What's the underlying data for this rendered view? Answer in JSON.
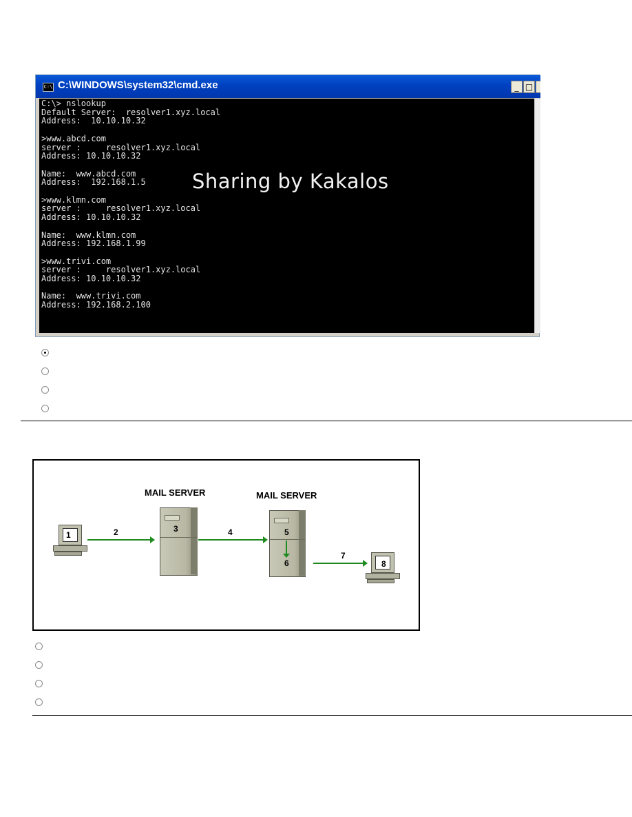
{
  "cmd_window": {
    "title": "C:\\WINDOWS\\system32\\cmd.exe",
    "icon_text": "C:\\",
    "minimize_label": "_",
    "maximize_label": "□",
    "close_label": "",
    "console_text": "C:\\> nslookup\nDefault Server:  resolver1.xyz.local\nAddress:  10.10.10.32\n\n>www.abcd.com\nserver :     resolver1.xyz.local\nAddress: 10.10.10.32\n\nName:  www.abcd.com\nAddress:  192.168.1.5\n\n>www.klmn.com\nserver :     resolver1.xyz.local\nAddress: 10.10.10.32\n\nName:  www.klmn.com\nAddress: 192.168.1.99\n\n>www.trivi.com\nserver :     resolver1.xyz.local\nAddress: 10.10.10.32\n\nName:  www.trivi.com\nAddress: 192.168.2.100",
    "watermark": "Sharing by Kakalos"
  },
  "question1": {
    "options": [
      {
        "selected": true
      },
      {
        "selected": false
      },
      {
        "selected": false
      },
      {
        "selected": false
      }
    ]
  },
  "mail_diagram": {
    "server_label_1": "MAIL SERVER",
    "server_label_2": "MAIL SERVER",
    "steps": [
      "1",
      "2",
      "3",
      "4",
      "5",
      "6",
      "7",
      "8"
    ],
    "arrow_color": "#1f8a1f"
  },
  "question2": {
    "options": [
      {
        "selected": false
      },
      {
        "selected": false
      },
      {
        "selected": false
      },
      {
        "selected": false
      }
    ]
  }
}
